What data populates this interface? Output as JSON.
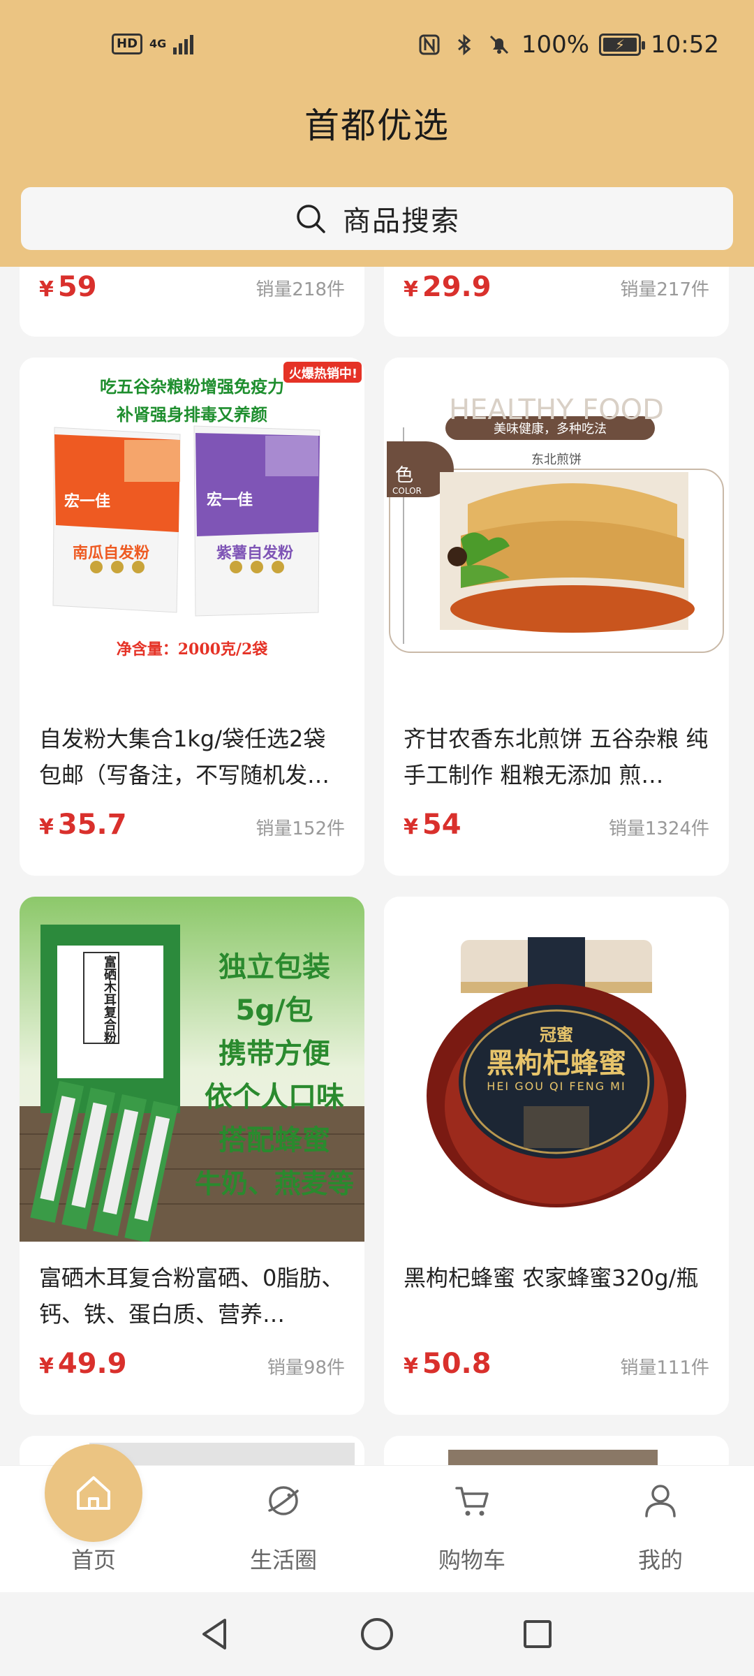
{
  "status_bar": {
    "hd": "HD",
    "network": "4G",
    "battery_pct": "100%",
    "time": "10:52"
  },
  "header": {
    "title": "首都优选",
    "search_label": "商品搜索",
    "bg_color": "#ebc482"
  },
  "products_top": [
    {
      "price_symbol": "¥",
      "price": "59",
      "sales": "销量218件"
    },
    {
      "price_symbol": "¥",
      "price": "29.9",
      "sales": "销量217件"
    }
  ],
  "products": [
    {
      "title": "自发粉大集合1kg/袋任选2袋包邮（写备注，不写随机发…",
      "price_symbol": "¥",
      "price": "35.7",
      "sales": "销量152件",
      "image": {
        "badge": "火爆热销中!",
        "line1": "吃五谷杂粮粉增强免疫力",
        "line2": "补肾强身排毒又养颜",
        "brand": "宏一佳",
        "bag1": "南瓜自发粉",
        "bag2": "紫薯自发粉",
        "net": "净含量：2000克/2袋"
      }
    },
    {
      "title": "齐甘农香东北煎饼 五谷杂粮 纯手工制作 粗粮无添加 煎…",
      "price_symbol": "¥",
      "price": "54",
      "sales": "销量1324件",
      "image": {
        "watermark": "HEALTHY FOOD",
        "tagline": "美味健康，多种吃法",
        "caption": "东北煎饼",
        "tab": "色",
        "tab_sub": "COLOR"
      }
    },
    {
      "title": "富硒木耳复合粉富硒、0脂肪、钙、铁、蛋白质、营养…",
      "price_symbol": "¥",
      "price": "49.9",
      "sales": "销量98件",
      "image": {
        "lines": [
          "独立包装",
          "5g/包",
          "携带方便",
          "依个人口味",
          "搭配蜂蜜",
          "牛奶、燕麦等"
        ],
        "box_text": "富硒木耳复合粉"
      }
    },
    {
      "title": "黑枸杞蜂蜜 农家蜂蜜320g/瓶",
      "price_symbol": "¥",
      "price": "50.8",
      "sales": "销量111件",
      "image": {
        "brand": "冠蜜",
        "label": "黑枸杞蜂蜜",
        "pinyin": "HEI GOU QI FENG MI"
      }
    }
  ],
  "bottom_nav": [
    {
      "label": "首页",
      "icon": "home-icon"
    },
    {
      "label": "生活圈",
      "icon": "planet-icon"
    },
    {
      "label": "购物车",
      "icon": "cart-icon"
    },
    {
      "label": "我的",
      "icon": "user-icon"
    }
  ],
  "colors": {
    "accent": "#ebc482",
    "price": "#d9302c"
  }
}
